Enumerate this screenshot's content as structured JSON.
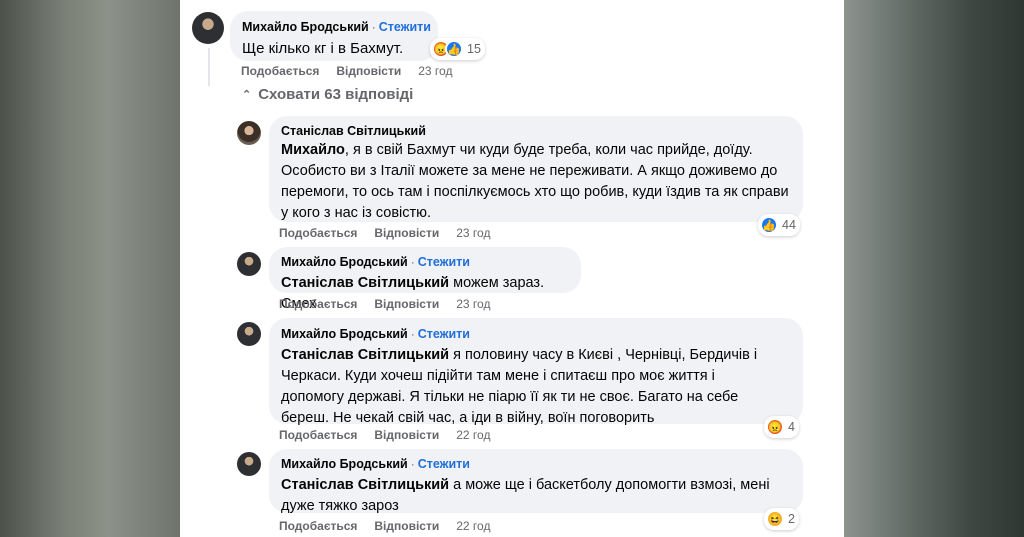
{
  "comments": [
    {
      "author": "Михайло Бродський",
      "follow": "Стежити",
      "mention": "",
      "text": "Ще кілько кг і в Бахмут.",
      "like_label": "Подобається",
      "reply_label": "Відповісти",
      "time": "23 год",
      "reactions": [
        "angry",
        "like"
      ],
      "reaction_count": "15"
    },
    {
      "author": "Станіслав Світлицький",
      "follow": "",
      "mention": "Михайло",
      "text": ", я в свій Бахмут чи куди буде треба, коли час прийде, доїду. Особисто ви з Італії можете за мене не переживати. А якщо доживемо до перемоги, то ось там і поспілкуємось хто що робив, куди їздив та як справи у кого з нас із совістю.",
      "like_label": "Подобається",
      "reply_label": "Відповісти",
      "time": "23 год",
      "reactions": [
        "like"
      ],
      "reaction_count": "44"
    },
    {
      "author": "Михайло Бродський",
      "follow": "Стежити",
      "mention": "Станіслав Світлицький",
      "text": " можем зараз. Смех",
      "like_label": "Подобається",
      "reply_label": "Відповісти",
      "time": "23 год",
      "reactions": [],
      "reaction_count": ""
    },
    {
      "author": "Михайло Бродський",
      "follow": "Стежити",
      "mention": "Станіслав Світлицький",
      "text": " я половину часу в Києві , Чернівці, Бердичів і Черкаси. Куди хочеш підійти там мене і спитаєш про моє життя і допомогу державі. Я тільки не піарю її як ти не своє. Багато на себе береш. Не чекай свій час, а іди в війну, воїн поговорить",
      "like_label": "Подобається",
      "reply_label": "Відповісти",
      "time": "22 год",
      "reactions": [
        "angry"
      ],
      "reaction_count": "4"
    },
    {
      "author": "Михайло Бродський",
      "follow": "Стежити",
      "mention": "Станіслав Світлицький",
      "text": " а може ще і баскетболу допомогти взмозі, мені дуже тяжко зароз",
      "like_label": "Подобається",
      "reply_label": "Відповісти",
      "time": "22 год",
      "reactions": [
        "haha"
      ],
      "reaction_count": "2"
    }
  ],
  "hide_replies_label": "Сховати 63 відповіді",
  "colors": {
    "link": "#216fdb",
    "bubble": "#f0f2f5",
    "meta": "#65676b",
    "like": "#1877f2"
  }
}
